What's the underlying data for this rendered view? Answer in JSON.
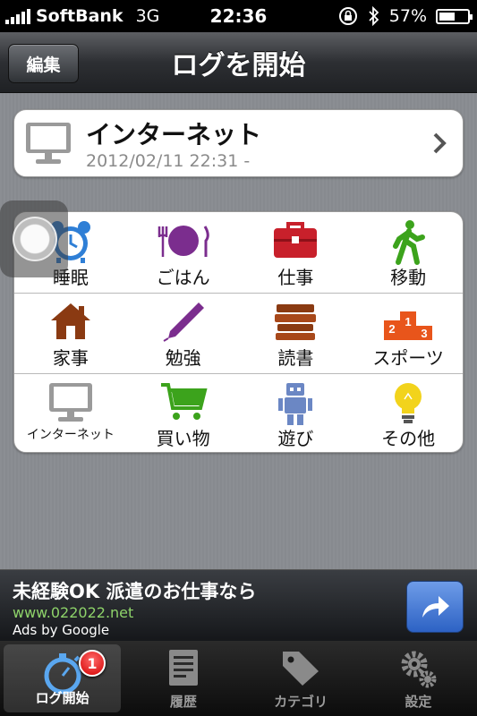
{
  "status_bar": {
    "carrier": "SoftBank",
    "network": "3G",
    "time": "22:36",
    "battery": "57%",
    "battery_level": 0.57
  },
  "nav": {
    "edit_label": "編集",
    "title": "ログを開始"
  },
  "current": {
    "icon": "monitor-icon",
    "name": "インターネット",
    "date": "2012/02/11 22:31 -"
  },
  "categories": [
    {
      "label": "睡眠",
      "icon": "alarm-clock-icon"
    },
    {
      "label": "ごはん",
      "icon": "plate-icon"
    },
    {
      "label": "仕事",
      "icon": "briefcase-icon"
    },
    {
      "label": "移動",
      "icon": "walking-person-icon"
    },
    {
      "label": "家事",
      "icon": "house-icon"
    },
    {
      "label": "勉強",
      "icon": "pen-icon"
    },
    {
      "label": "読書",
      "icon": "books-icon"
    },
    {
      "label": "スポーツ",
      "icon": "podium-icon"
    },
    {
      "label": "インターネット",
      "icon": "monitor-icon"
    },
    {
      "label": "買い物",
      "icon": "shopping-cart-icon"
    },
    {
      "label": "遊び",
      "icon": "robot-icon"
    },
    {
      "label": "その他",
      "icon": "lightbulb-icon"
    }
  ],
  "podium": {
    "first": "1",
    "second": "2",
    "third": "3"
  },
  "ad": {
    "headline": "未経験OK 派遣のお仕事なら",
    "url": "www.022022.net",
    "by": "Ads by Google"
  },
  "tabs": [
    {
      "label": "ログ開始",
      "icon": "stopwatch-icon",
      "badge": "1"
    },
    {
      "label": "履歴",
      "icon": "document-icon"
    },
    {
      "label": "カテゴリ",
      "icon": "tag-icon"
    },
    {
      "label": "設定",
      "icon": "gears-icon"
    }
  ],
  "colors": {
    "blue": "#2f7fd6",
    "purple": "#7b2d8e",
    "red": "#c8202b",
    "green": "#3ca31c",
    "brown": "#8a3a12",
    "orange": "#e8551b",
    "gray": "#9a9a9a",
    "yellow": "#f2d31c"
  }
}
